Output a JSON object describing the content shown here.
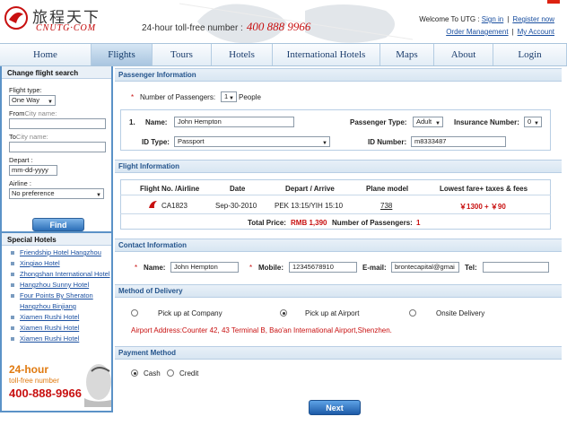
{
  "header": {
    "logo_cn": "旅程天下",
    "logo_en": "CNUTG·COM",
    "tollfree_label": "24-hour toll-free number :",
    "tollfree_number": "400 888 9966",
    "welcome": "Welcome To UTG :",
    "sign_in": "Sign in",
    "register": "Register now",
    "order_mgmt": "Order Management",
    "my_account": "My Account",
    "sep": "|"
  },
  "nav": {
    "tabs": [
      {
        "label": "Home",
        "width": 102
      },
      {
        "label": "Flights",
        "width": 68
      },
      {
        "label": "Tours",
        "width": 66
      },
      {
        "label": "Hotels",
        "width": 68
      },
      {
        "label": "International Hotels",
        "width": 120
      },
      {
        "label": "Maps",
        "width": 60
      },
      {
        "label": "About",
        "width": 66
      },
      {
        "label": "Login",
        "width": 82
      }
    ],
    "active": "Flights"
  },
  "sidebar": {
    "change_title": "Change flight search",
    "flight_type_label": "Flight type:",
    "flight_type_value": "One Way",
    "from_label": "From",
    "from_placeholder": "City name:",
    "to_label": "To",
    "to_placeholder": "City name:",
    "depart_label": "Depart :",
    "depart_value": "mm-dd-yyyy",
    "airline_label": "Airline :",
    "airline_value": "No preference",
    "find_label": "Find",
    "hotels_title": "Special Hotels",
    "hotels": [
      "Friendship Hotel Hangzhou",
      "Xingiao Hotel",
      "Zhongshan International Hotel",
      "Hangzhou Sunny Hotel",
      "Four Points By Sheraton Hangzhou Binjiang",
      "Xiamen Rushi Hotel",
      "Xiamen Rushi Hotel",
      "Xiamen Rushi Hotel"
    ],
    "ad_24": "24-hour",
    "ad_tollfree": "toll-free number",
    "ad_phone": "400-888-9966"
  },
  "passenger": {
    "section_title": "Passenger Information",
    "num_label": "Number of Passengers:",
    "num_value": "1",
    "people": "People",
    "index": "1.",
    "name_label": "Name:",
    "name_value": "John Hempton",
    "ptype_label": "Passenger Type:",
    "ptype_value": "Adult",
    "ins_label": "Insurance Number:",
    "ins_value": "0",
    "idtype_label": "ID Type:",
    "idtype_value": "Passport",
    "idnum_label": "ID Number:",
    "idnum_value": "m8333487"
  },
  "flight": {
    "section_title": "Flight Information",
    "headers": [
      "Flight No. /Airline",
      "Date",
      "Depart / Arrive",
      "Plane model",
      "Lowest fare+ taxes & fees"
    ],
    "row": {
      "flight_no": "CA1823",
      "date": "Sep-30-2010",
      "depart_arrive": "PEK 13:15/YIH 15:10",
      "plane": "738",
      "fare": "￥1300 + ￥90"
    },
    "total_label": "Total Price:",
    "total_value": "RMB 1,390",
    "num_pass_label": "Number of Passengers:",
    "num_pass_value": "1"
  },
  "contact": {
    "section_title": "Contact Information",
    "name_label": "Name:",
    "name_value": "John Hempton",
    "mobile_label": "Mobile:",
    "mobile_value": "12345678910",
    "email_label": "E-mail:",
    "email_value": "brontecapital@gmai",
    "tel_label": "Tel:",
    "tel_value": ""
  },
  "delivery": {
    "section_title": "Method of Delivery",
    "options": [
      "Pick up at Company",
      "Pick up at Airport",
      "Onsite Delivery"
    ],
    "selected": "Pick up at Airport",
    "address": "Airport Address:Counter 42, 43 Terminal B, Bao'an International Airport,Shenzhen."
  },
  "payment": {
    "section_title": "Payment Method",
    "options": [
      "Cash",
      "Credit"
    ],
    "selected": "Cash"
  },
  "next_label": "Next",
  "colors": {
    "accent": "#5b92c7",
    "brand_red": "#c81010",
    "orange": "#e07a10"
  }
}
